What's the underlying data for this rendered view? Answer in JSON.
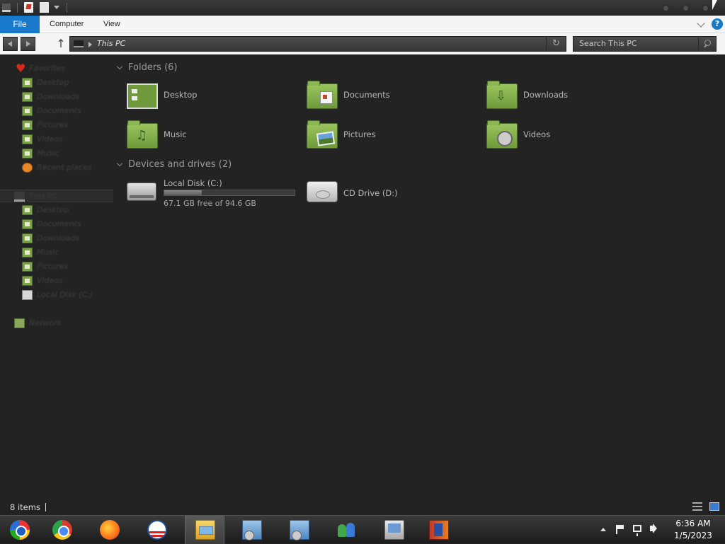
{
  "ribbon": {
    "tabs": [
      {
        "label": "File"
      },
      {
        "label": "Computer"
      },
      {
        "label": "View"
      }
    ],
    "help_label": "?"
  },
  "address": {
    "location": "This PC",
    "search_placeholder": "Search This PC"
  },
  "nav_pane": {
    "favorites": {
      "label": "Favorites",
      "items": [
        {
          "label": "Desktop",
          "icon": "desktop-icon"
        },
        {
          "label": "Downloads",
          "icon": "downloads-folder-icon"
        },
        {
          "label": "Documents",
          "icon": "documents-folder-icon"
        },
        {
          "label": "Pictures",
          "icon": "pictures-folder-icon"
        },
        {
          "label": "Videos",
          "icon": "videos-folder-icon"
        },
        {
          "label": "Music",
          "icon": "music-folder-icon"
        },
        {
          "label": "Recent places",
          "icon": "recent-places-icon"
        }
      ]
    },
    "this_pc": {
      "label": "This PC",
      "items": [
        {
          "label": "Desktop",
          "icon": "desktop-icon"
        },
        {
          "label": "Documents",
          "icon": "documents-folder-icon"
        },
        {
          "label": "Downloads",
          "icon": "downloads-folder-icon"
        },
        {
          "label": "Music",
          "icon": "music-folder-icon"
        },
        {
          "label": "Pictures",
          "icon": "pictures-folder-icon"
        },
        {
          "label": "Videos",
          "icon": "videos-folder-icon"
        },
        {
          "label": "Local Disk (C:)",
          "icon": "hard-drive-icon"
        }
      ]
    },
    "network": {
      "label": "Network",
      "icon": "network-icon"
    }
  },
  "content": {
    "folders_heading": "Folders (6)",
    "folders": [
      {
        "label": "Desktop",
        "icon": "desktop-folder-icon"
      },
      {
        "label": "Documents",
        "icon": "documents-folder-icon"
      },
      {
        "label": "Downloads",
        "icon": "downloads-folder-icon"
      },
      {
        "label": "Music",
        "icon": "music-folder-icon"
      },
      {
        "label": "Pictures",
        "icon": "pictures-folder-icon"
      },
      {
        "label": "Videos",
        "icon": "videos-folder-icon"
      }
    ],
    "devices_heading": "Devices and drives (2)",
    "drives": [
      {
        "label": "Local Disk (C:)",
        "free_text": "67.1 GB free of 94.6 GB",
        "used_fraction": 0.29,
        "icon": "hard-drive-icon"
      },
      {
        "label": "CD Drive (D:)",
        "icon": "cd-drive-icon"
      }
    ]
  },
  "status": {
    "items_text": "8 items"
  },
  "taskbar": {
    "apps": [
      {
        "name": "start-button",
        "icon": "start-orb-icon"
      },
      {
        "name": "chrome",
        "icon": "chrome-icon"
      },
      {
        "name": "firefox",
        "icon": "firefox-icon"
      },
      {
        "name": "obama-app",
        "icon": "obama-logo-icon"
      },
      {
        "name": "file-explorer",
        "icon": "file-explorer-icon",
        "active": true
      },
      {
        "name": "setup-1",
        "icon": "setup-icon"
      },
      {
        "name": "setup-2",
        "icon": "setup-icon"
      },
      {
        "name": "users",
        "icon": "users-icon"
      },
      {
        "name": "remote-desktop",
        "icon": "monitor-icon"
      },
      {
        "name": "winrar",
        "icon": "winrar-icon"
      }
    ],
    "clock": {
      "time": "6:36 AM",
      "date": "1/5/2023"
    }
  },
  "colors": {
    "accent": "#1979ca",
    "window_bg": "#232323",
    "folder_green": "#7aa34a"
  }
}
